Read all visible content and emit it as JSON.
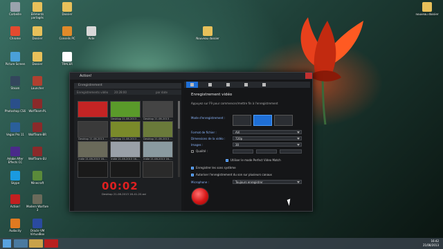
{
  "desktop_icons": [
    {
      "label": "Corbeille",
      "color": "#9aa3ad"
    },
    {
      "label": "Eléments partagés",
      "color": "#e8c05a"
    },
    {
      "label": "Dossier",
      "color": "#e8c05a"
    },
    {
      "label": "Chrome",
      "color": "#e34a2f"
    },
    {
      "label": "Dossier",
      "color": "#e8c05a"
    },
    {
      "label": "Conseils PC",
      "color": "#e08a2a"
    },
    {
      "label": "Aide",
      "color": "#d8d8d8"
    },
    {
      "label": "Picture Screen",
      "color": "#4aa0d8"
    },
    {
      "label": "Dossier",
      "color": "#e8c05a"
    },
    {
      "label": "TRACER",
      "color": "#ffffff"
    },
    {
      "label": "Steam",
      "color": "#33465c"
    },
    {
      "label": "Launcher",
      "color": "#b04030"
    },
    {
      "label": "Photoshop CS6",
      "color": "#2a4f8a"
    },
    {
      "label": "WolfTeam-PL",
      "color": "#8a2a2a"
    },
    {
      "label": "Vegas Pro 11",
      "color": "#2a5f9a"
    },
    {
      "label": "WolfTeam-BR",
      "color": "#8a2a2a"
    },
    {
      "label": "Adobe After Effects CC",
      "color": "#4a2a8a"
    },
    {
      "label": "WolfTeam-EU",
      "color": "#8a2a2a"
    },
    {
      "label": "Skype",
      "color": "#1a9ae0"
    },
    {
      "label": "Minecraft",
      "color": "#5a8a3a"
    },
    {
      "label": "Action!",
      "color": "#c22020"
    },
    {
      "label": "Modern Warfare 3",
      "color": "#6a6a5a"
    },
    {
      "label": "Audacity",
      "color": "#e07a20"
    },
    {
      "label": "Oracle VM VirtualBox",
      "color": "#2a4aa0"
    },
    {
      "label": "Nouveau dossier",
      "color": "#e8c05a"
    },
    {
      "label": "nouveau dossier",
      "color": "#e8c05a"
    }
  ],
  "window": {
    "title": "Action!",
    "left_header": "Enregistrement",
    "left_bar": [
      "Enregistrements vidéo",
      "20:28:00",
      "par date"
    ],
    "thumbs": [
      {
        "caption": "",
        "color": "#c42424"
      },
      {
        "caption": "Desktop 21-08-2013 ...",
        "color": "#5a9a2a"
      },
      {
        "caption": "Desktop 21-08-2013 ...",
        "color": "#444"
      },
      {
        "caption": "Desktop 21-08-2013 ...",
        "color": "#3a3a3a"
      },
      {
        "caption": "Desktop 21-08-2013 ...",
        "color": "#7a8a2a"
      },
      {
        "caption": "Desktop 21-08-2013 ...",
        "color": "#6a7a3a"
      },
      {
        "caption": "Indie 21-08-2013 16-...",
        "color": "#6a6a5a"
      },
      {
        "caption": "Indie 21-08-2013 16-...",
        "color": "#9aa0a8"
      },
      {
        "caption": "Indie 21-08-2013 16-...",
        "color": "#8a9aa0"
      },
      {
        "caption": "",
        "color": "#1a1a1a"
      },
      {
        "caption": "",
        "color": "#1a1a1a"
      },
      {
        "caption": "",
        "color": "#2a2a2a"
      }
    ],
    "timer": "00:02",
    "timer_caption": "Desktop 21-08-2013 16-41-20.avi",
    "panel_title": "Enregistrement vidéo",
    "panel_sub": "Appuyez sur F9 pour commencer/mettre fin à l'enregistrement",
    "mode_label": "Mode d'enregistrement :",
    "format_label": "Format de fichier :",
    "format_value": "AVI",
    "resolution_label": "Dimensions de la vidéo :",
    "resolution_value": "720p",
    "fps_label": "Images :",
    "fps_value": "30",
    "quality_label": "Qualité :",
    "quality_small": [
      "",
      "",
      ""
    ],
    "checkbox_perfect": "Utiliser le mode Perfect Video Match",
    "checkbox_audio": "Enregistrer les sons système",
    "checkbox_mic": "Autoriser l'enregistrement du son sur plusieurs canaux",
    "mic_label": "Microphone :",
    "mic_value": "Toujours enregistrer"
  },
  "clock": {
    "time": "16:42",
    "date": "21/08/2013"
  }
}
